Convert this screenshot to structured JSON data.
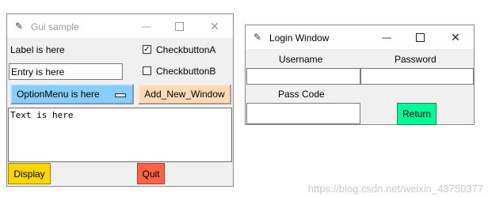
{
  "gui": {
    "title": "Gui sample",
    "label": "Label is here",
    "checkA": "CheckbuttonA",
    "checkA_checked": true,
    "checkB": "CheckbuttonB",
    "checkB_checked": false,
    "entry_value": "Entry is here",
    "option_menu": "OptionMenu is here",
    "add_window_button": "Add_New_Window",
    "text_content": "Text is here",
    "display_button": "Display",
    "quit_button": "Quit",
    "colors": {
      "option_bg": "#87cefa",
      "add_bg": "#ffdab9",
      "display_bg": "#ffd700",
      "quit_bg": "#ff6347"
    }
  },
  "login": {
    "title": "Login Window",
    "username_label": "Username",
    "password_label": "Password",
    "passcode_label": "Pass Code",
    "return_button": "Return",
    "colors": {
      "return_bg": "#00fa9a"
    }
  },
  "watermark": "https://blog.csdn.net/weixin_43750377"
}
